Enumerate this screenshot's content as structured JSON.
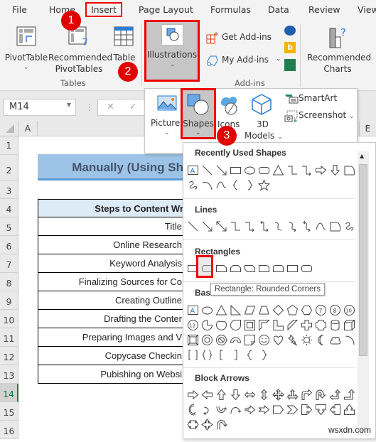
{
  "menu": {
    "tabs": [
      "File",
      "Home",
      "Insert",
      "Page Layout",
      "Formulas",
      "Data",
      "Review",
      "View"
    ],
    "active": "Insert"
  },
  "ribbon": {
    "pivot_table": "PivotTable",
    "recommended_pivot_1": "Recommended",
    "recommended_pivot_2": "PivotTables",
    "table": "Table",
    "group_tables": "Tables",
    "illustrations": "Illustrations",
    "get_addins": "Get Add-ins",
    "my_addins": "My Add-ins",
    "group_addins": "Add-ins",
    "recommended_charts_1": "Recommended",
    "recommended_charts_2": "Charts"
  },
  "badges": [
    "1",
    "2",
    "3"
  ],
  "illustrations_menu": {
    "pictures": "Pictures",
    "shapes": "Shapes",
    "icons": "Icons",
    "models_1": "3D",
    "models_2": "Models",
    "smartart": "SmartArt",
    "screenshot": "Screenshot"
  },
  "formula_bar": {
    "name_box": "M14",
    "cancel": "✕",
    "enter": "✓"
  },
  "grid": {
    "columns": [
      "A",
      "E"
    ],
    "rows": [
      "1",
      "2",
      "3",
      "4",
      "5",
      "6",
      "7",
      "8",
      "9",
      "10",
      "11",
      "12",
      "13",
      "14",
      "15",
      "16"
    ],
    "selected_row": "14",
    "title": "Manually (Using Sh",
    "table_header": "Steps to Content Wr",
    "table_rows": [
      "Title",
      "Online Research",
      "Keyword Analysis",
      "Finalizing Sources for Co",
      "Creating Outline",
      "Drafting the Conter",
      "Preparing Images and V",
      "Copycase Checkin",
      "Pubishing on Websi"
    ]
  },
  "shapes_gallery": {
    "sections": [
      "Recently Used Shapes",
      "Lines",
      "Rectangles",
      "Basic Shapes",
      "Block Arrows"
    ],
    "basic_label_visible": "Bas",
    "tooltip": "Rectangle: Rounded Corners",
    "selected_shape": "Rectangle: Rounded Corners"
  },
  "watermark": "wsxdn.com",
  "colors": {
    "accent_red": "#e10000",
    "title_fill": "#9dc3e6",
    "header_fill": "#ddebf7",
    "excel_green": "#217346"
  }
}
